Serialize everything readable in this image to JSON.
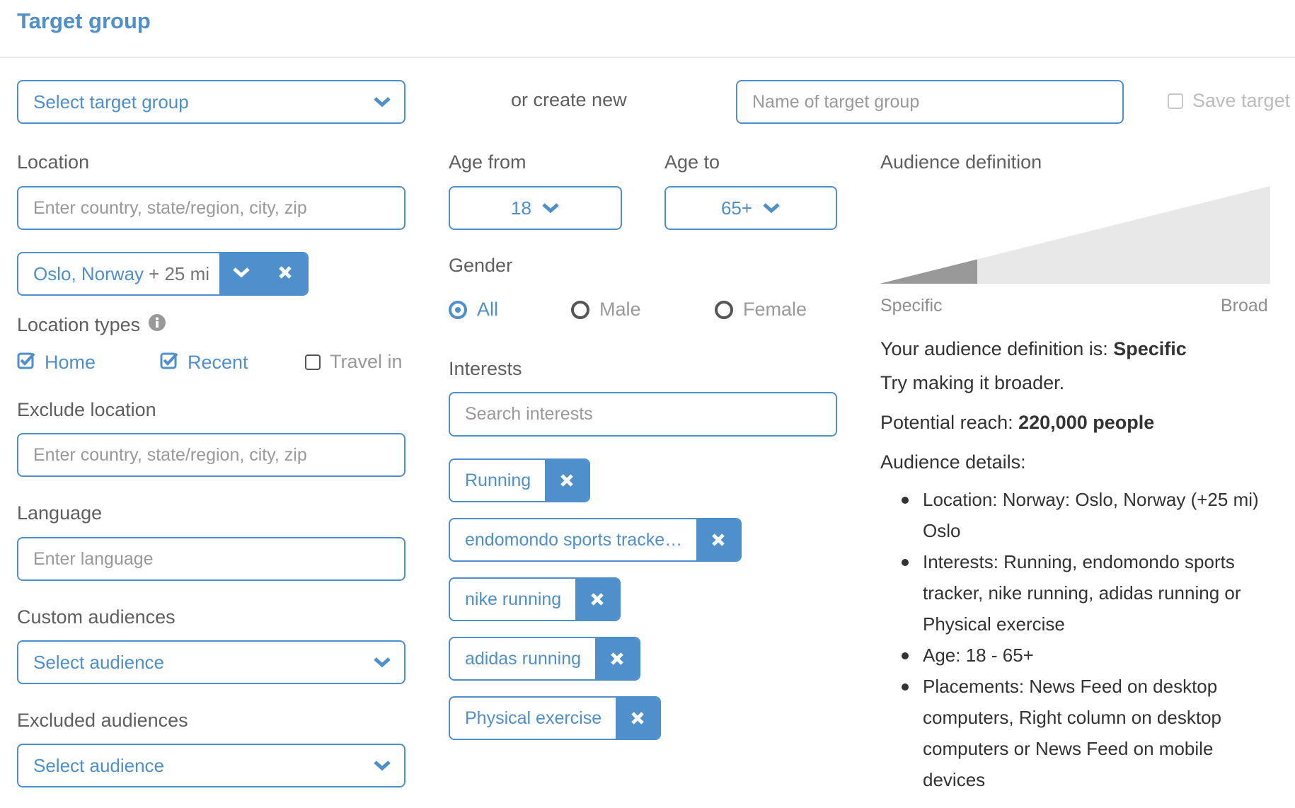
{
  "header": {
    "title": "Target group"
  },
  "target_group": {
    "select_placeholder": "Select target group",
    "or_create_new": "or create new",
    "name_placeholder": "Name of target group",
    "save_label": "Save target",
    "save_checked": false
  },
  "location": {
    "label": "Location",
    "placeholder": "Enter country, state/region, city, zip",
    "selected": {
      "place": "Oslo, Norway",
      "radius": "+ 25 mi"
    }
  },
  "location_types": {
    "label": "Location types",
    "info_icon": "info-circle-icon",
    "options": [
      {
        "label": "Home",
        "checked": true
      },
      {
        "label": "Recent",
        "checked": true
      },
      {
        "label": "Travel in",
        "checked": false
      }
    ]
  },
  "exclude_location": {
    "label": "Exclude location",
    "placeholder": "Enter country, state/region, city, zip"
  },
  "language": {
    "label": "Language",
    "placeholder": "Enter language"
  },
  "custom_audiences": {
    "label": "Custom audiences",
    "value": "Select audience"
  },
  "excluded_audiences": {
    "label": "Excluded audiences",
    "value": "Select audience"
  },
  "age": {
    "from_label": "Age from",
    "from_value": "18",
    "to_label": "Age to",
    "to_value": "65+"
  },
  "gender": {
    "label": "Gender",
    "options": [
      {
        "label": "All",
        "selected": true
      },
      {
        "label": "Male",
        "selected": false
      },
      {
        "label": "Female",
        "selected": false
      }
    ]
  },
  "interests": {
    "label": "Interests",
    "placeholder": "Search interests",
    "tags": [
      "Running",
      "endomondo sports tracke…",
      "nike running",
      "adidas running",
      "Physical exercise"
    ]
  },
  "audience_definition": {
    "label": "Audience definition",
    "gauge_fraction": 0.25,
    "min_label": "Specific",
    "max_label": "Broad",
    "definition_prefix": "Your audience definition is: ",
    "definition_value": "Specific",
    "hint": "Try making it broader.",
    "reach_prefix": "Potential reach: ",
    "reach_value": "220,000 people",
    "details_label": "Audience details:",
    "details": [
      "Location: Norway: Oslo, Norway (+25 mi) Oslo",
      "Interests: Running, endomondo sports tracker, nike running, adidas running or Physical exercise",
      "Age: 18 - 65+",
      "Placements: News Feed on desktop computers, Right column on desktop computers or News Feed on mobile devices"
    ]
  },
  "colors": {
    "accent": "#4f8fcc",
    "gauge_fill": "#999999",
    "gauge_track": "#e8e8e8",
    "text": "#333333",
    "muted": "#9a9a9a"
  }
}
